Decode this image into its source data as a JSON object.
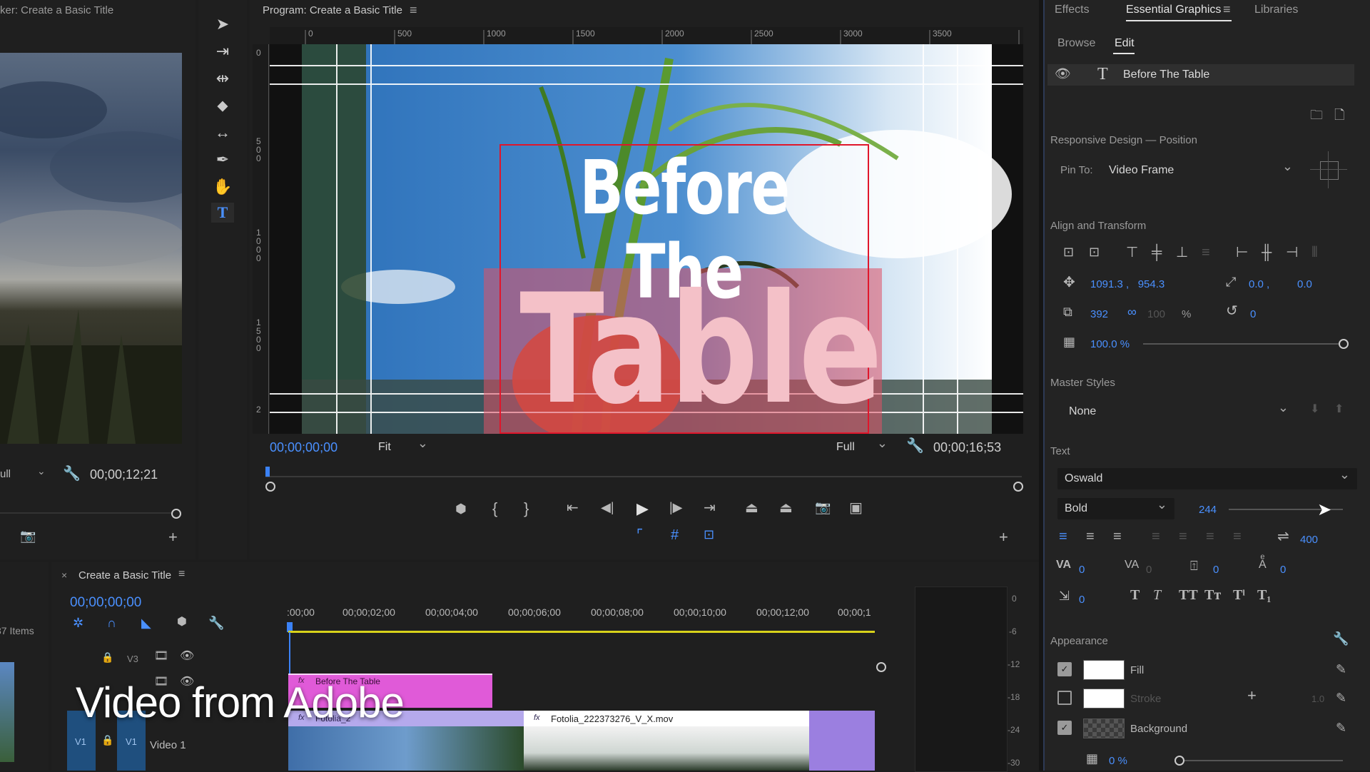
{
  "source_monitor": {
    "title": "ker: Create a Basic Title",
    "quality": "ull",
    "timecode": "00;00;12;21"
  },
  "program_monitor": {
    "title": "Program: Create a Basic Title",
    "ruler_top": [
      "0",
      "500",
      "1000",
      "1500",
      "2000",
      "2500",
      "3000",
      "3500"
    ],
    "ruler_left": [
      "0",
      "5\n0\n0",
      "1\n0\n0\n0",
      "1\n5\n0\n0",
      "2"
    ],
    "title_line1": "Before The",
    "title_line2": "Table",
    "timecode_current": "00;00;00;00",
    "fit": "Fit",
    "quality": "Full",
    "timecode_duration": "00;00;16;53"
  },
  "timeline": {
    "project_items": "37 Items",
    "tab_close": "×",
    "tab_title": "Create a Basic Title",
    "timecode": "00;00;00;00",
    "time_ticks": [
      ":00;00",
      "00;00;02;00",
      "00;00;04;00",
      "00;00;06;00",
      "00;00;08;00",
      "00;00;10;00",
      "00;00;12;00",
      "00;00;1"
    ],
    "tracks": [
      {
        "id": "V3",
        "target": "",
        "name": ""
      },
      {
        "id": "V2",
        "target": "",
        "name": ""
      },
      {
        "id": "V1",
        "target": "V1",
        "name": "Video 1"
      }
    ],
    "clips": [
      {
        "name": "Before The Table",
        "track": "V2",
        "badge": "fx"
      },
      {
        "name": "Fotolia_2",
        "track": "V1",
        "badge": "fx"
      },
      {
        "name": "Fotolia_222373276_V_X.mov",
        "track": "V1",
        "badge": "fx"
      }
    ],
    "meter_labels": [
      "0",
      "-6",
      "-12",
      "-18",
      "-24",
      "-30"
    ]
  },
  "watermark": "Video from Adobe",
  "essential_graphics": {
    "tabs": [
      "Effects",
      "Essential Graphics",
      "Libraries"
    ],
    "subtabs": [
      "Browse",
      "Edit"
    ],
    "layer_name": "Before The Table",
    "responsive_heading": "Responsive Design — Position",
    "pin_to_label": "Pin To:",
    "pin_to_value": "Video Frame",
    "align_heading": "Align and Transform",
    "position": "1091.3 ,   954.3",
    "anchor": "0.0 ,",
    "anchor_y": "0.0",
    "scale": "392",
    "scale_height": "100",
    "percent": "%",
    "rotation": "0",
    "opacity": "100.0 %",
    "opacity_level": 1.0,
    "master_styles_heading": "Master Styles",
    "master_styles_value": "None",
    "text_heading": "Text",
    "font": "Oswald",
    "font_style": "Bold",
    "font_size": "244",
    "font_size_level": 0.85,
    "leading": "400",
    "kerning": "0",
    "tracking": "0",
    "baseline": "0",
    "tsume": "0",
    "indent": "0",
    "appearance_heading": "Appearance",
    "fill_label": "Fill",
    "fill_color": "#ffffff",
    "fill_checked": true,
    "stroke_label": "Stroke",
    "stroke_color": "#ffffff",
    "stroke_checked": false,
    "stroke_width": "1.0",
    "background_label": "Background",
    "background_checked": true,
    "background_opacity": "0 %"
  },
  "colors": {
    "accent_blue": "#4a90ff",
    "title_box_red": "#e0162b",
    "clip_pink": "#e05ad8",
    "clip_purple": "#9b7fe0",
    "playhead_blue": "#3b82f6"
  }
}
